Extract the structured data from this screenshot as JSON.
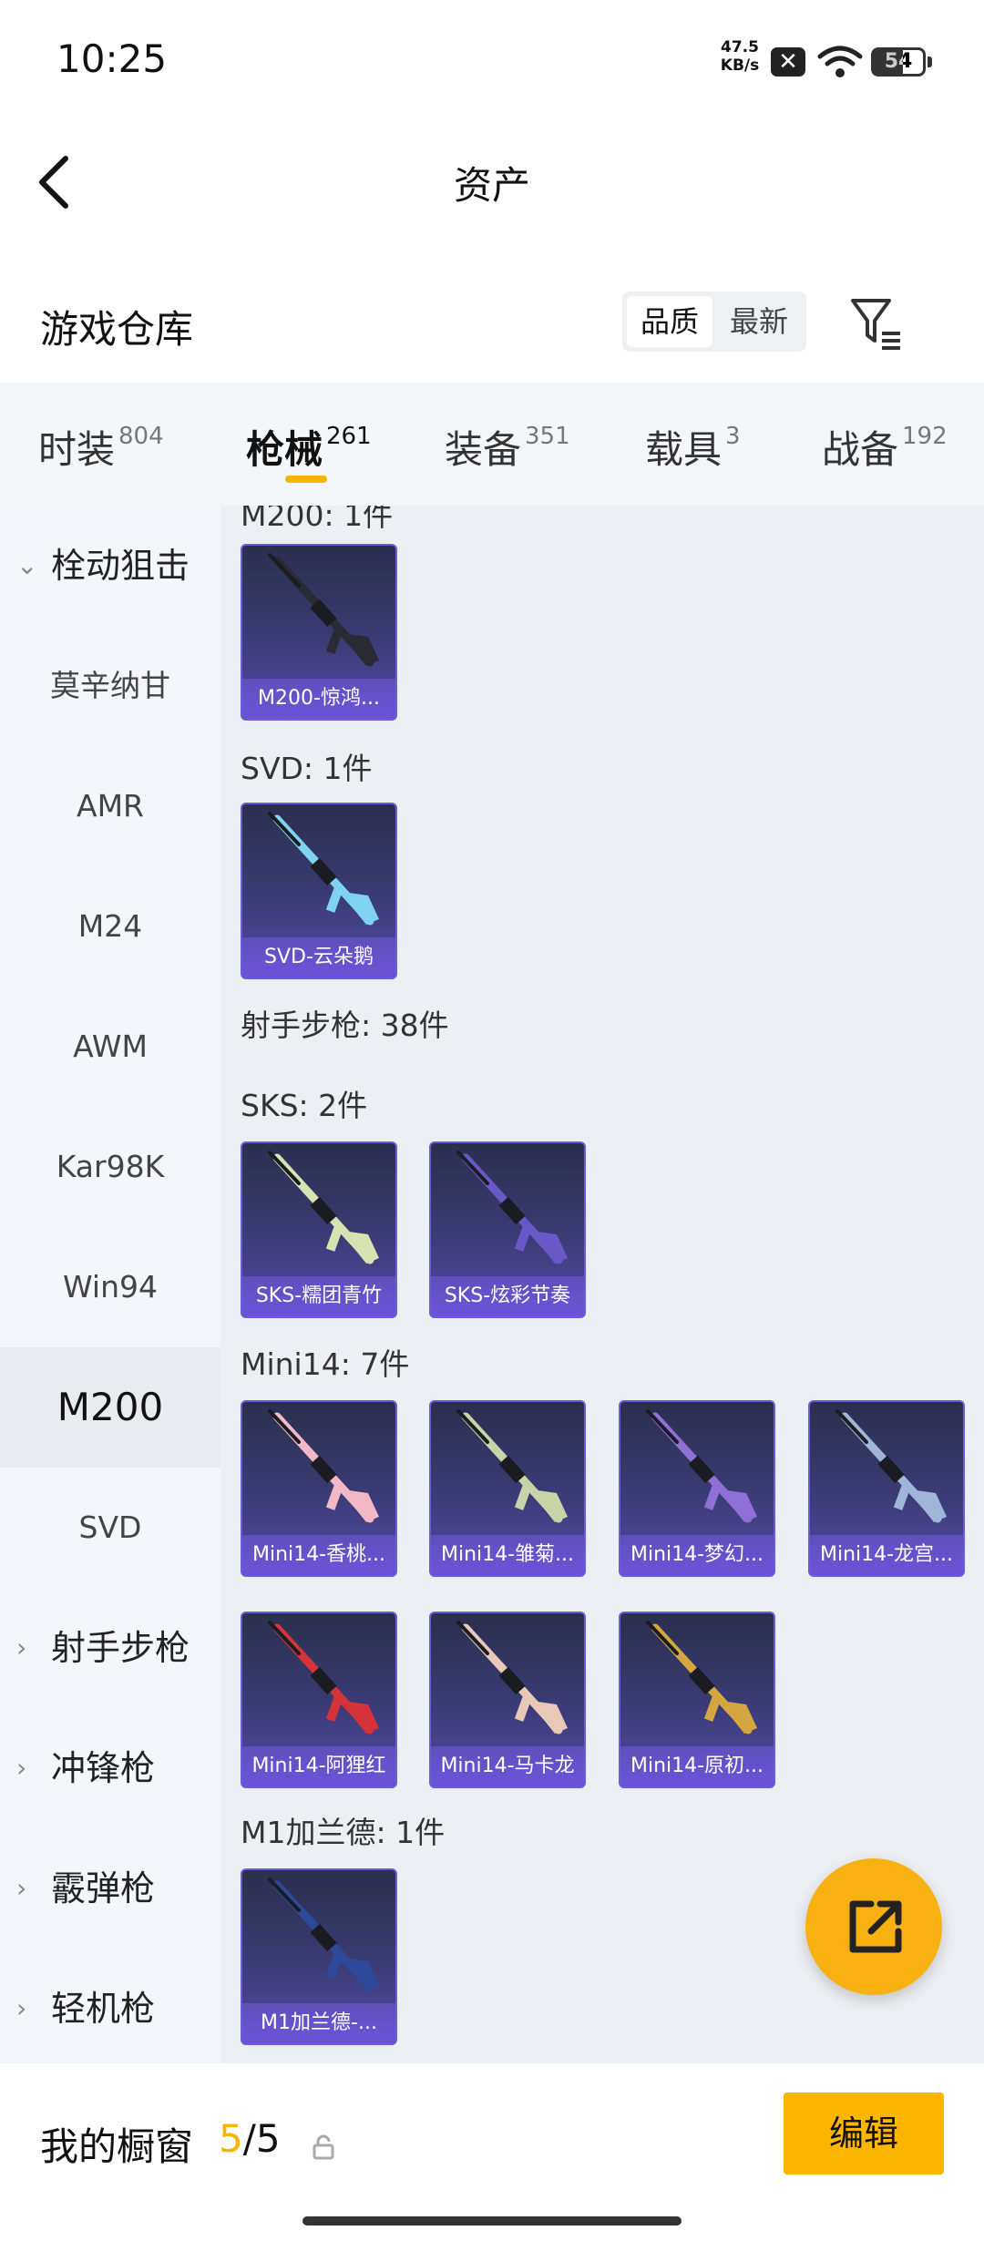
{
  "status_bar": {
    "time": "10:25",
    "net_speed_value": "47.5",
    "net_speed_unit": "KB/s",
    "battery": "54"
  },
  "header": {
    "title": "资产"
  },
  "warehouse": {
    "title": "游戏仓库",
    "sort_options": [
      "品质",
      "最新"
    ],
    "selected_sort": "品质"
  },
  "tabs": [
    {
      "label": "时装",
      "count": "804"
    },
    {
      "label": "枪械",
      "count": "261",
      "active": true
    },
    {
      "label": "装备",
      "count": "351"
    },
    {
      "label": "载具",
      "count": "3"
    },
    {
      "label": "战备",
      "count": "192"
    }
  ],
  "sidebar": {
    "items": [
      {
        "label": "栓动狙击",
        "type": "group",
        "expanded": true
      },
      {
        "label": "莫辛纳甘"
      },
      {
        "label": "AMR"
      },
      {
        "label": "M24"
      },
      {
        "label": "AWM"
      },
      {
        "label": "Kar98K"
      },
      {
        "label": "Win94"
      },
      {
        "label": "M200",
        "selected": true
      },
      {
        "label": "SVD"
      },
      {
        "label": "射手步枪",
        "type": "group"
      },
      {
        "label": "冲锋枪",
        "type": "group"
      },
      {
        "label": "霰弹枪",
        "type": "group"
      },
      {
        "label": "轻机枪",
        "type": "group"
      }
    ]
  },
  "content": {
    "sections": [
      {
        "title": "M200: 1件",
        "items": [
          "M200-惊鸿..."
        ]
      },
      {
        "title": "SVD: 1件",
        "items": [
          "SVD-云朵鹅"
        ]
      },
      {
        "title": "射手步枪: 38件",
        "items": []
      },
      {
        "title": "SKS: 2件",
        "items": [
          "SKS-糯团青竹",
          "SKS-炫彩节奏"
        ]
      },
      {
        "title": "Mini14: 7件",
        "items": [
          "Mini14-香桃...",
          "Mini14-雏菊...",
          "Mini14-梦幻...",
          "Mini14-龙宫...",
          "Mini14-阿狸红",
          "Mini14-马卡龙",
          "Mini14-原初..."
        ]
      },
      {
        "title": "M1加兰德: 1件",
        "items": [
          "M1加兰德-..."
        ]
      }
    ],
    "gun_colors": [
      "#2a2a34",
      "#7fd3f0",
      "#d7e3b0",
      "#6b58c8",
      "#f2b8c6",
      "#c9d3a8",
      "#8f6fd8",
      "#9fb6d8",
      "#d6323a",
      "#e9c8b8",
      "#d4a640",
      "#2d4a9a"
    ]
  },
  "bottom_bar": {
    "label": "我的橱窗",
    "count_current": "5",
    "count_separator": "/",
    "count_total": "5",
    "edit_label": "编辑"
  },
  "colors": {
    "accent": "#f7b500",
    "card_gradient_end": "#5649a8"
  },
  "icons": [
    "back-arrow-icon",
    "filter-icon",
    "lock-icon",
    "share-icon",
    "chevron-down-icon",
    "chevron-right-icon",
    "wifi-icon",
    "battery-icon"
  ]
}
